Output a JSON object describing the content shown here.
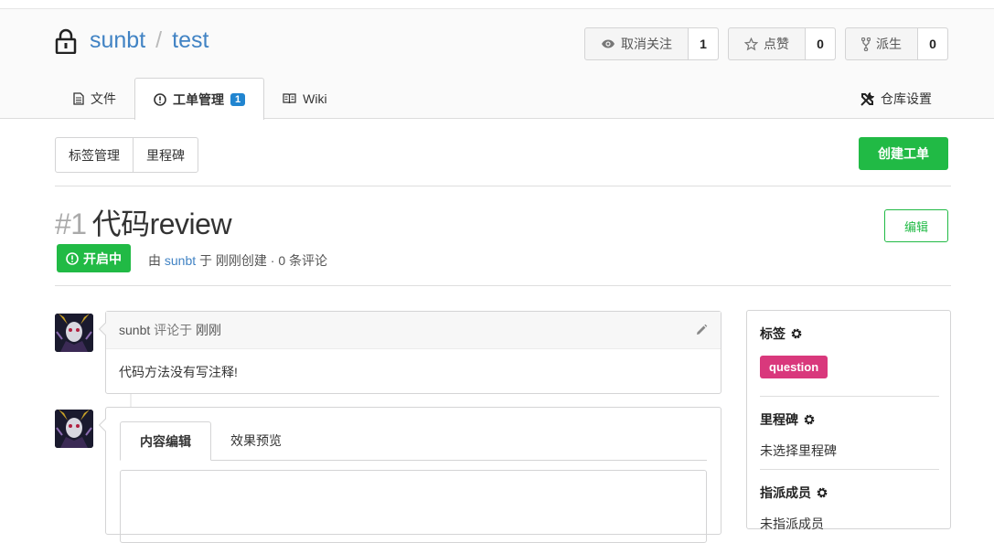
{
  "repo": {
    "owner": "sunbt",
    "separator": "/",
    "name": "test"
  },
  "actions": [
    {
      "label": "取消关注",
      "count": "1",
      "icon": "eye-icon"
    },
    {
      "label": "点赞",
      "count": "0",
      "icon": "star-icon"
    },
    {
      "label": "派生",
      "count": "0",
      "icon": "fork-icon"
    }
  ],
  "tabs": {
    "files": "文件",
    "issues": "工单管理",
    "issues_count": "1",
    "wiki": "Wiki",
    "settings": "仓库设置"
  },
  "subnav": {
    "labels": "标签管理",
    "milestones": "里程碑"
  },
  "create_issue": "创建工单",
  "issue": {
    "number": "#1",
    "title": "代码review",
    "edit": "编辑",
    "status": "开启中",
    "meta_prefix": "由",
    "author": "sunbt",
    "meta_suffix": "于 刚刚创建 · 0 条评论"
  },
  "comment": {
    "author": "sunbt",
    "commented_at": "评论于",
    "time": "刚刚",
    "body": "代码方法没有写注释!"
  },
  "editor": {
    "tab_write": "内容编辑",
    "tab_preview": "效果预览"
  },
  "sidebar": {
    "labels_title": "标签",
    "label": "question",
    "label_color": "#d9387c",
    "milestone_title": "里程碑",
    "milestone_value": "未选择里程碑",
    "assignee_title": "指派成员",
    "assignee_value": "未指派成员"
  },
  "colors": {
    "accent": "#21ba45",
    "link": "#4183c4",
    "badge": "#2185d0"
  }
}
